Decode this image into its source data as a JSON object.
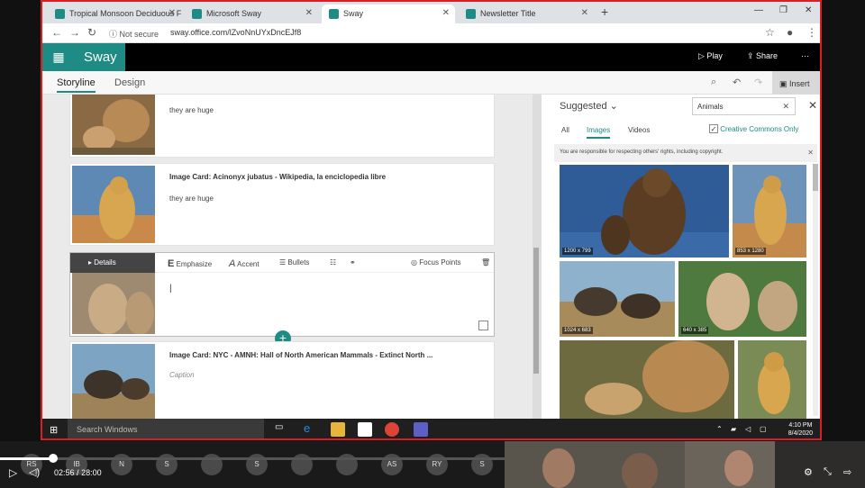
{
  "browser": {
    "tabs": [
      {
        "label": "Tropical Monsoon Deciduous Fo"
      },
      {
        "label": "Microsoft Sway"
      },
      {
        "label": "Sway"
      },
      {
        "label": "Newsletter Title"
      }
    ],
    "security": "Not secure",
    "url": "sway.office.com/lZvoNnUYxDncEJf8"
  },
  "app": {
    "brand": "Sway",
    "play_label": "Play",
    "share_label": "Share",
    "more_label": "···",
    "tabs": [
      {
        "label": "Storyline"
      },
      {
        "label": "Design"
      }
    ],
    "insert_label": "Insert"
  },
  "storyline": {
    "cards": [
      {
        "text": "they are huge"
      },
      {
        "title": "Image Card: Acinonyx jubatus - Wikipedia, la enciclopedia libre",
        "text": "they are huge"
      },
      {
        "details_label": "Details",
        "emphasize": "Emphasize",
        "accent": "Accent",
        "bullets": "Bullets",
        "focus_points": "Focus Points"
      },
      {
        "title": "Image Card: NYC - AMNH: Hall of North American Mammals - Extinct North ...",
        "caption": "Caption"
      }
    ]
  },
  "panel": {
    "title": "Suggested",
    "search_value": "Animals",
    "filters": [
      {
        "label": "All"
      },
      {
        "label": "Images"
      },
      {
        "label": "Videos"
      }
    ],
    "cc_label": "Creative Commons Only",
    "notice": "You are responsible for respecting others' rights, including copyright.",
    "images": [
      {
        "dims": "1200 x 799"
      },
      {
        "dims": "853 x 1280"
      },
      {
        "dims": "1024 x 683"
      },
      {
        "dims": "640 x 385"
      }
    ]
  },
  "taskbar": {
    "search": "Search Windows",
    "time": "4:10 PM",
    "date": "8/4/2020"
  },
  "video": {
    "current": "02:56",
    "separator": "/",
    "duration": "28:00",
    "progress": 0.105,
    "participants": [
      "RS",
      "IB",
      "N",
      "S",
      "",
      "S",
      "",
      "",
      "AS",
      "RY",
      "S"
    ]
  }
}
